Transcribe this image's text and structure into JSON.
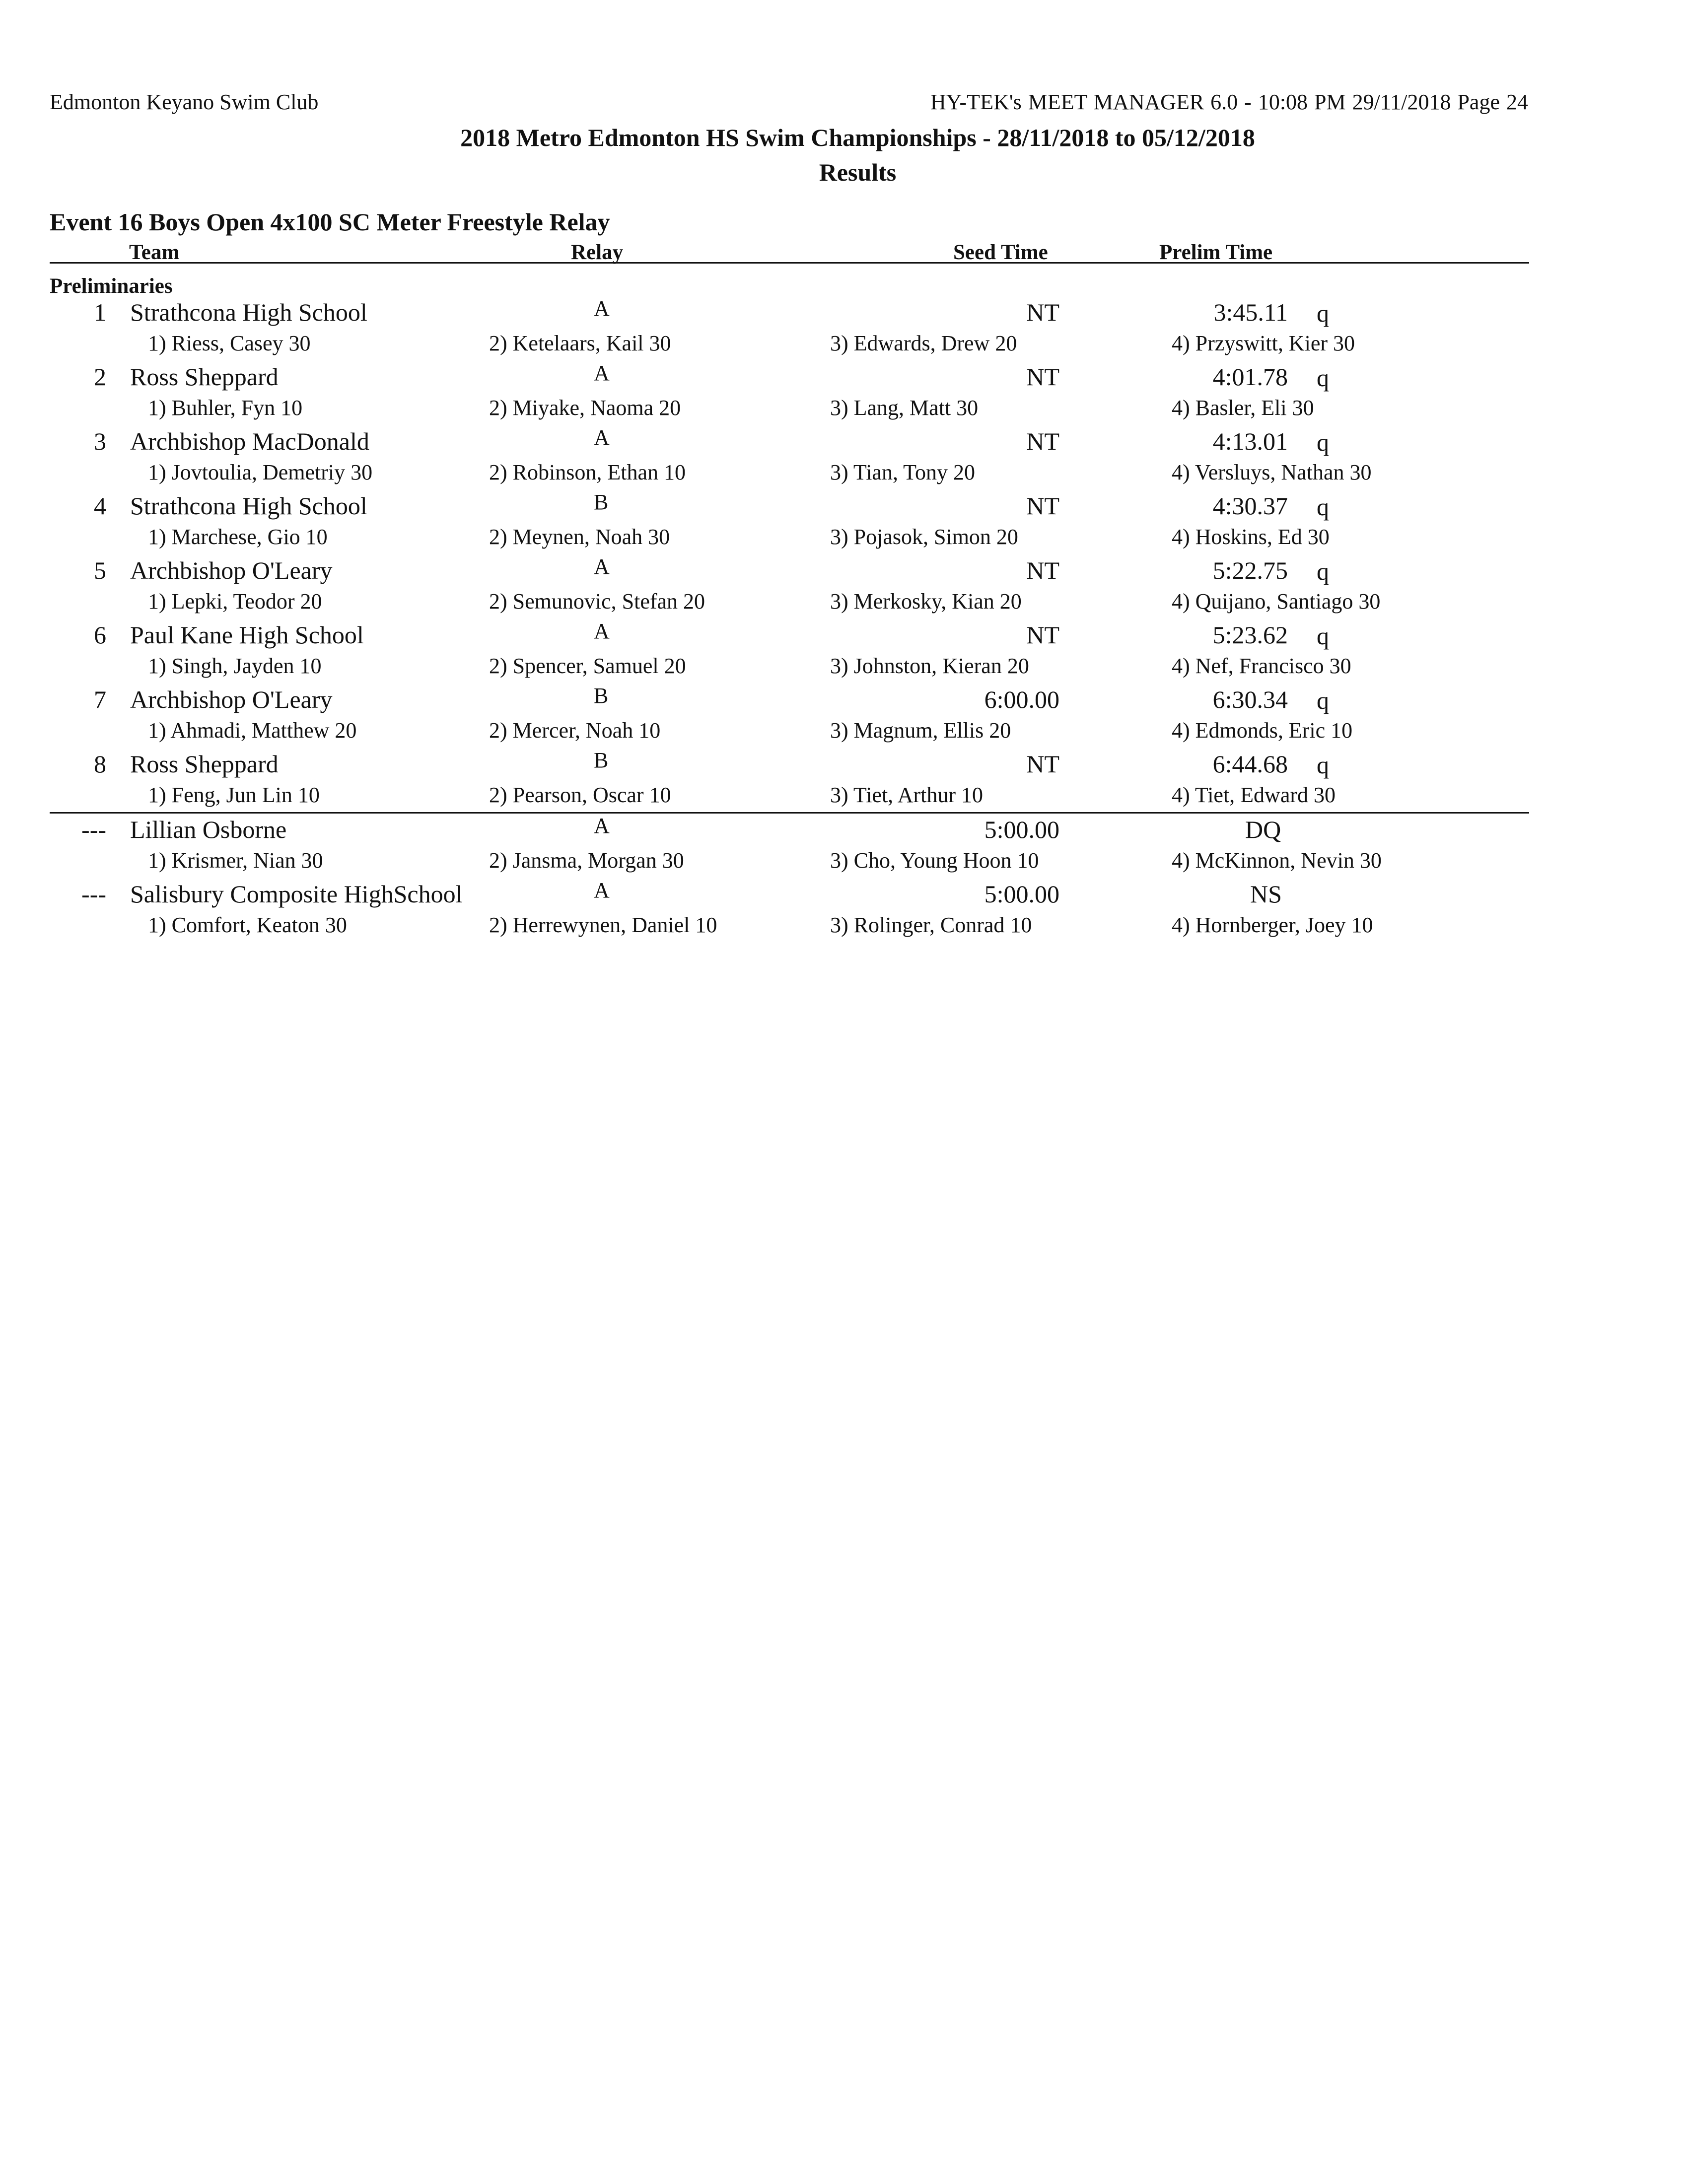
{
  "header": {
    "left": "Edmonton Keyano Swim Club",
    "right": "HY-TEK's MEET MANAGER 6.0 - 10:08 PM  29/11/2018  Page 24"
  },
  "meet_title": "2018 Metro Edmonton HS Swim Championships - 28/11/2018 to 05/12/2018",
  "subtitle": "Results",
  "event_title": "Event 16  Boys Open 4x100 SC Meter Freestyle Relay",
  "columns": {
    "team": "Team",
    "relay": "Relay",
    "seed_time": "Seed Time",
    "prelim_time": "Prelim Time"
  },
  "section": "Preliminaries",
  "results": [
    {
      "rank": "1",
      "team": "Strathcona High School",
      "relay": "A",
      "seed": "NT",
      "prelim": "3:45.11",
      "qual": "q",
      "swimmers": [
        "1) Riess, Casey 30",
        "2) Ketelaars, Kail 30",
        "3) Edwards, Drew 20",
        "4) Przyswitt, Kier 30"
      ]
    },
    {
      "rank": "2",
      "team": "Ross Sheppard",
      "relay": "A",
      "seed": "NT",
      "prelim": "4:01.78",
      "qual": "q",
      "swimmers": [
        "1) Buhler, Fyn 10",
        "2) Miyake, Naoma 20",
        "3) Lang, Matt 30",
        "4) Basler, Eli 30"
      ]
    },
    {
      "rank": "3",
      "team": "Archbishop MacDonald",
      "relay": "A",
      "seed": "NT",
      "prelim": "4:13.01",
      "qual": "q",
      "swimmers": [
        "1) Jovtoulia, Demetriy 30",
        "2) Robinson, Ethan 10",
        "3) Tian, Tony 20",
        "4) Versluys, Nathan 30"
      ]
    },
    {
      "rank": "4",
      "team": "Strathcona High School",
      "relay": "B",
      "seed": "NT",
      "prelim": "4:30.37",
      "qual": "q",
      "swimmers": [
        "1) Marchese, Gio 10",
        "2) Meynen, Noah 30",
        "3) Pojasok, Simon 20",
        "4) Hoskins, Ed 30"
      ]
    },
    {
      "rank": "5",
      "team": "Archbishop O'Leary",
      "relay": "A",
      "seed": "NT",
      "prelim": "5:22.75",
      "qual": "q",
      "swimmers": [
        "1) Lepki, Teodor 20",
        "2) Semunovic, Stefan 20",
        "3) Merkosky, Kian 20",
        "4) Quijano, Santiago 30"
      ]
    },
    {
      "rank": "6",
      "team": "Paul Kane High School",
      "relay": "A",
      "seed": "NT",
      "prelim": "5:23.62",
      "qual": "q",
      "swimmers": [
        "1) Singh, Jayden 10",
        "2) Spencer, Samuel 20",
        "3) Johnston, Kieran 20",
        "4) Nef, Francisco 30"
      ]
    },
    {
      "rank": "7",
      "team": "Archbishop O'Leary",
      "relay": "B",
      "seed": "6:00.00",
      "prelim": "6:30.34",
      "qual": "q",
      "swimmers": [
        "1) Ahmadi, Matthew 20",
        "2) Mercer, Noah 10",
        "3) Magnum, Ellis 20",
        "4) Edmonds, Eric 10"
      ]
    },
    {
      "rank": "8",
      "team": "Ross Sheppard",
      "relay": "B",
      "seed": "NT",
      "prelim": "6:44.68",
      "qual": "q",
      "swimmers": [
        "1) Feng, Jun Lin 10",
        "2) Pearson, Oscar 10",
        "3) Tiet, Arthur 10",
        "4) Tiet, Edward 30"
      ]
    },
    {
      "rank": "---",
      "team": "Lillian Osborne",
      "relay": "A",
      "seed": "5:00.00",
      "prelim": "DQ",
      "qual": "",
      "swimmers": [
        "1) Krismer, Nian 30",
        "2) Jansma, Morgan 30",
        "3) Cho, Young Hoon 10",
        "4) McKinnon, Nevin 30"
      ]
    },
    {
      "rank": "---",
      "team": "Salisbury Composite HighSchool",
      "relay": "A",
      "seed": "5:00.00",
      "prelim": "NS",
      "qual": "",
      "swimmers": [
        "1) Comfort, Keaton 30",
        "2) Herrewynen, Daniel 10",
        "3) Rolinger, Conrad 10",
        "4) Hornberger, Joey 10"
      ]
    }
  ]
}
